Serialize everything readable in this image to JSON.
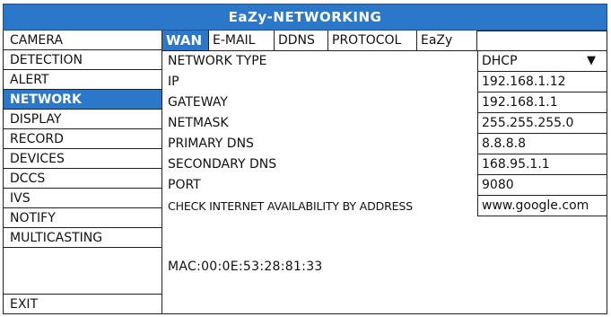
{
  "title": "EaZy-NETWORKING",
  "sidebar": {
    "items": [
      {
        "label": "CAMERA"
      },
      {
        "label": "DETECTION"
      },
      {
        "label": "ALERT"
      },
      {
        "label": "NETWORK",
        "active": true
      },
      {
        "label": "DISPLAY"
      },
      {
        "label": "RECORD"
      },
      {
        "label": "DEVICES"
      },
      {
        "label": "DCCS"
      },
      {
        "label": "IVS"
      },
      {
        "label": "NOTIFY"
      },
      {
        "label": "MULTICASTING"
      }
    ],
    "exit_label": "EXIT"
  },
  "tabs": [
    {
      "label": "WAN",
      "active": true
    },
    {
      "label": "E-MAIL"
    },
    {
      "label": "DDNS"
    },
    {
      "label": "PROTOCOL"
    },
    {
      "label": "EaZy"
    }
  ],
  "settings": [
    {
      "label": "NETWORK TYPE",
      "value": "DHCP",
      "dropdown_arrow": "▼"
    },
    {
      "label": "IP",
      "value": "192.168.1.12"
    },
    {
      "label": "GATEWAY",
      "value": "192.168.1.1"
    },
    {
      "label": "NETMASK",
      "value": "255.255.255.0"
    },
    {
      "label": "PRIMARY DNS",
      "value": "8.8.8.8"
    },
    {
      "label": "SECONDARY DNS",
      "value": "168.95.1.1"
    },
    {
      "label": "PORT",
      "value": "9080"
    },
    {
      "label": "CHECK INTERNET AVAILABILITY BY ADDRESS",
      "value": "www.google.com"
    }
  ],
  "mac": "MAC:00:0E:53:28:81:33",
  "colors": {
    "accent": "#2b77c9",
    "border": "#222222",
    "background": "#ffffff"
  }
}
